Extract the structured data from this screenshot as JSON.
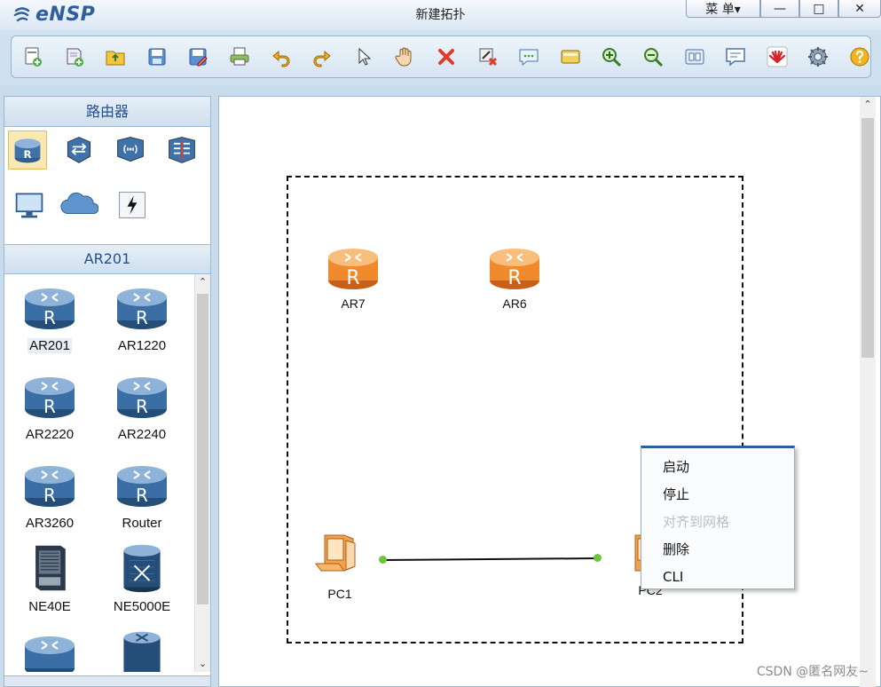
{
  "app": {
    "logo_text": "eNSP",
    "window_title": "新建拓扑",
    "menu_label": "菜 单▾",
    "minimize_label": "—",
    "maximize_label": "□",
    "close_label": "✕"
  },
  "toolbar": {
    "items": [
      "new-topology-icon",
      "new-lab-icon",
      "open-icon",
      "save-icon",
      "save-as-icon",
      "print-icon",
      "undo-icon",
      "redo-icon",
      "select-icon",
      "pan-hand-icon",
      "delete-icon",
      "delete-link-icon",
      "text-icon",
      "rectangle-icon",
      "zoom-in-icon",
      "zoom-out-icon",
      "fit-icon",
      "chat-icon",
      "huawei-icon",
      "settings-icon",
      "help-icon"
    ]
  },
  "left_panel": {
    "category_title": "路由器",
    "category_icons": [
      "router-category-icon",
      "switch-category-icon",
      "wireless-category-icon",
      "firewall-category-icon",
      "pc-category-icon",
      "cloud-category-icon",
      "other-category-icon"
    ],
    "sub_title": "AR201",
    "devices": [
      {
        "label": "AR201"
      },
      {
        "label": "AR1220"
      },
      {
        "label": "AR2220"
      },
      {
        "label": "AR2240"
      },
      {
        "label": "AR3260"
      },
      {
        "label": "Router"
      },
      {
        "label": "NE40E"
      },
      {
        "label": "NE5000E"
      }
    ]
  },
  "canvas": {
    "nodes": [
      {
        "label": "AR7"
      },
      {
        "label": "AR6"
      },
      {
        "label": "PC1"
      },
      {
        "label": "PC2"
      }
    ]
  },
  "context_menu": {
    "items": [
      {
        "label": "启动",
        "enabled": true
      },
      {
        "label": "停止",
        "enabled": true
      },
      {
        "label": "对齐到网格",
        "enabled": false
      },
      {
        "label": "删除",
        "enabled": true
      },
      {
        "label": "CLI",
        "enabled": true
      }
    ]
  },
  "watermark": "CSDN @匿名网友~",
  "colors": {
    "router_orange": "#f08a2c",
    "router_blue": "#3f73a8",
    "link_port_green": "#6cc43a",
    "menu_accent": "#2c5f9e"
  }
}
